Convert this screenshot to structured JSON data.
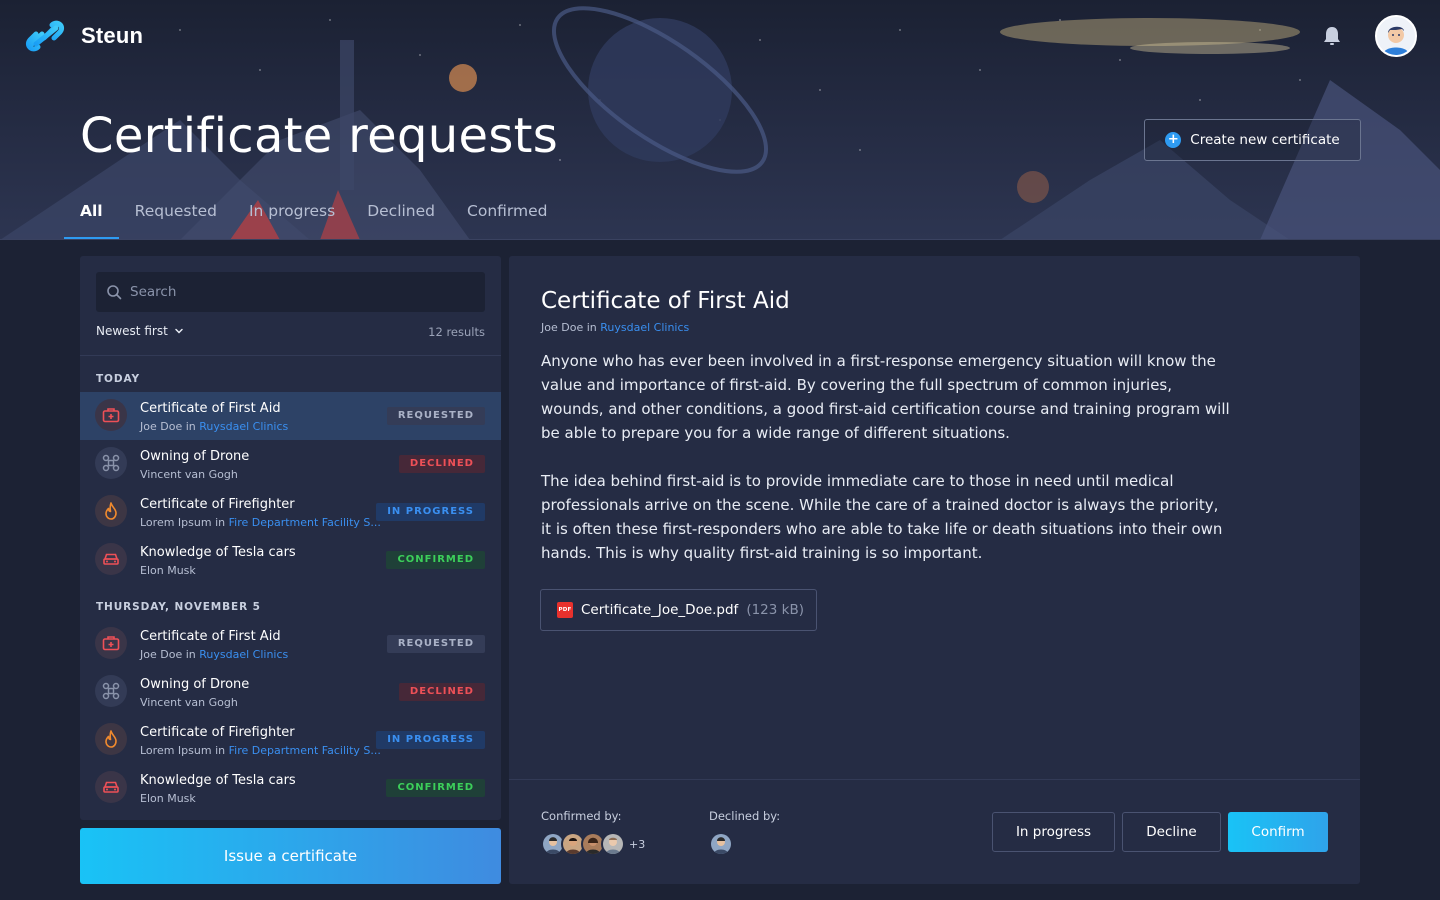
{
  "app": {
    "name": "Steun"
  },
  "header": {
    "title": "Certificate requests",
    "create_button": "Create new certificate",
    "tabs": [
      {
        "label": "All",
        "active": true
      },
      {
        "label": "Requested",
        "active": false
      },
      {
        "label": "In progress",
        "active": false
      },
      {
        "label": "Declined",
        "active": false
      },
      {
        "label": "Confirmed",
        "active": false
      }
    ]
  },
  "list": {
    "search_placeholder": "Search",
    "sort_label": "Newest first",
    "results": "12 results",
    "groups": [
      {
        "label": "TODAY",
        "items": [
          {
            "title": "Certificate of First Aid",
            "person": "Joe Doe",
            "in": " in ",
            "place": "Ruysdael Clinics",
            "status": "REQUESTED",
            "icon": "first-aid-kit-icon",
            "selected": true
          },
          {
            "title": "Owning of Drone",
            "person": "Vincent van Gogh",
            "in": "",
            "place": "",
            "status": "DECLINED",
            "icon": "drone-icon",
            "selected": false
          },
          {
            "title": "Certificate of Firefighter",
            "person": "Lorem Ipsum",
            "in": " in ",
            "place": "Fire Department Facility S...",
            "status": "IN PROGRESS",
            "icon": "flame-icon",
            "selected": false
          },
          {
            "title": "Knowledge of Tesla cars",
            "person": "Elon Musk",
            "in": "",
            "place": "",
            "status": "CONFIRMED",
            "icon": "car-icon",
            "selected": false
          }
        ]
      },
      {
        "label": "THURSDAY, NOVEMBER 5",
        "items": [
          {
            "title": "Certificate of First Aid",
            "person": "Joe Doe",
            "in": " in ",
            "place": "Ruysdael Clinics",
            "status": "REQUESTED",
            "icon": "first-aid-kit-icon",
            "selected": false
          },
          {
            "title": "Owning of Drone",
            "person": "Vincent van Gogh",
            "in": "",
            "place": "",
            "status": "DECLINED",
            "icon": "drone-icon",
            "selected": false
          },
          {
            "title": "Certificate of Firefighter",
            "person": "Lorem Ipsum",
            "in": " in ",
            "place": "Fire Department Facility S...",
            "status": "IN PROGRESS",
            "icon": "flame-icon",
            "selected": false
          },
          {
            "title": "Knowledge of Tesla cars",
            "person": "Elon Musk",
            "in": "",
            "place": "",
            "status": "CONFIRMED",
            "icon": "car-icon",
            "selected": false
          }
        ]
      }
    ],
    "issue_button": "Issue a certificate"
  },
  "detail": {
    "title": "Certificate of First Aid",
    "person": "Joe Doe",
    "in": " in ",
    "place": "Ruysdael Clinics",
    "paragraph1": "Anyone who has ever been involved in a first-response emergency situation will know the value and importance of first-aid. By covering the full spectrum of common injuries, wounds, and other conditions, a good first-aid certification course and training program will be able to prepare you for a wide range of different situations.",
    "paragraph2": "The idea behind first-aid is to provide immediate care to those in need until medical professionals arrive on the scene. While the care of a trained doctor is always the priority, it is often these first-responders who are able to take life or death situations into their own hands. This is why quality first-aid training is so important.",
    "file_name": "Certificate_Joe_Doe.pdf",
    "file_size": "(123 kB)",
    "pdf_tag": "PDF",
    "confirmed_by_label": "Confirmed by:",
    "confirmed_more": "+3",
    "declined_by_label": "Declined by:",
    "actions": {
      "in_progress": "In progress",
      "decline": "Decline",
      "confirm": "Confirm"
    }
  },
  "colors": {
    "accent": "#2e9bf2",
    "requested": "#aab2c7",
    "declined": "#ee5057",
    "in_progress": "#3a8ff0",
    "confirmed": "#3ccf5a"
  }
}
